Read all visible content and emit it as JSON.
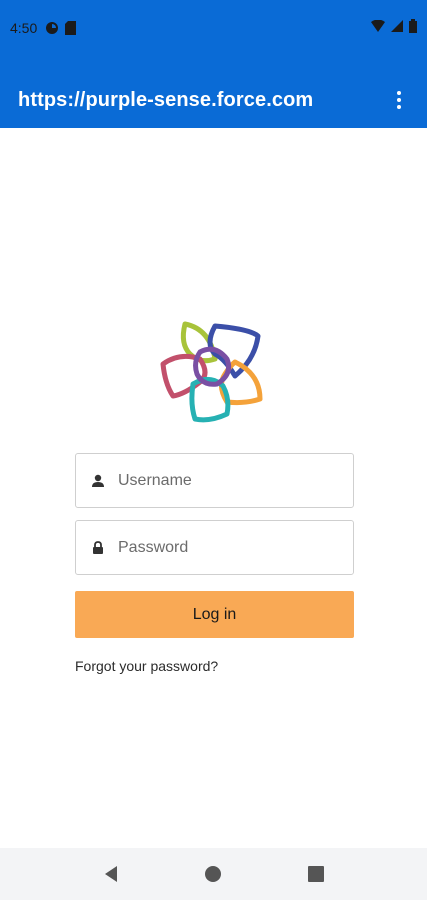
{
  "status_bar": {
    "time": "4:50",
    "left_icons": [
      "data-saver-icon",
      "sd-card-icon"
    ],
    "right_icons": [
      "wifi-icon",
      "cell-signal-icon",
      "battery-icon"
    ]
  },
  "toolbar": {
    "url": "https://purple-sense.force.com",
    "menu_icon": "more-vert-icon",
    "color": "#0a6bd6"
  },
  "login_form": {
    "username": {
      "placeholder": "Username",
      "value": "",
      "icon": "user-icon"
    },
    "password": {
      "placeholder": "Password",
      "value": "",
      "icon": "lock-icon"
    },
    "login_label": "Log in",
    "login_color": "#f9a955",
    "forgot_label": "Forgot your password?"
  },
  "nav_bar": {
    "buttons": [
      "back-icon",
      "home-icon",
      "recents-icon"
    ]
  },
  "logo": {
    "name": "knot-star-logo"
  }
}
